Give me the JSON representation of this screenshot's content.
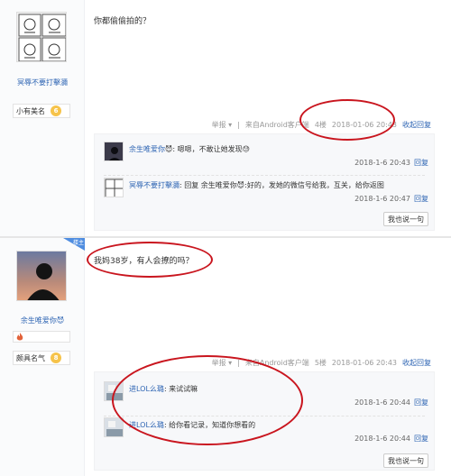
{
  "post1": {
    "username": "冥辱不要打擊瀰",
    "badge_title": "小有美名",
    "badge_level": "6",
    "content": "你都偷偷拍的？",
    "meta": {
      "report": "举报 ▾",
      "source": "来自Android客户端",
      "floor": "4楼",
      "time": "2018-01-06 20:43",
      "reply": "收起回复"
    },
    "replies": [
      {
        "name": "余生唯爱你",
        "emoji": "😈",
        "text": ": 嗯嗯，不敢让她发现",
        "trail_emoji": "😓",
        "time": "2018-1-6 20:43",
        "reply": "回复"
      },
      {
        "name": "冥辱不要打擊瀰",
        "text": ": 回复 ",
        "target": "余生唯爱你",
        "emoji": "😈",
        "text2": ":好的，发她的微信号给我，互关，给你返图",
        "time": "2018-1-6 20:47",
        "reply": "回复"
      }
    ],
    "say_button": "我也说一句"
  },
  "post2": {
    "username": "余生唯爱你",
    "name_emoji": "😈",
    "badge_title": "颇具名气",
    "badge_level": "8",
    "louzhu": "楼主",
    "content": "我妈38岁，有人会撩的吗？",
    "meta": {
      "report": "举报 ▾",
      "source": "来自Android客户端",
      "floor": "5楼",
      "time": "2018-01-06 20:43",
      "reply": "收起回复"
    },
    "replies": [
      {
        "name": "进LOL么璐",
        "text": ": 来试试嘛",
        "time": "2018-1-6 20:44",
        "reply": "回复"
      },
      {
        "name": "进LOL么璐",
        "text": ": 给你看记录，知道你想看的",
        "time": "2018-1-6 20:44",
        "reply": "回复"
      }
    ],
    "say_button": "我也说一句"
  },
  "colors": {
    "link": "#2d64b3",
    "annotation": "#c9151e",
    "level_badge": "#f6c34a"
  },
  "icons": [
    "comic-avatar-icon",
    "silhouette-avatar-icon",
    "flame-icon",
    "louzhu-ribbon-icon"
  ]
}
